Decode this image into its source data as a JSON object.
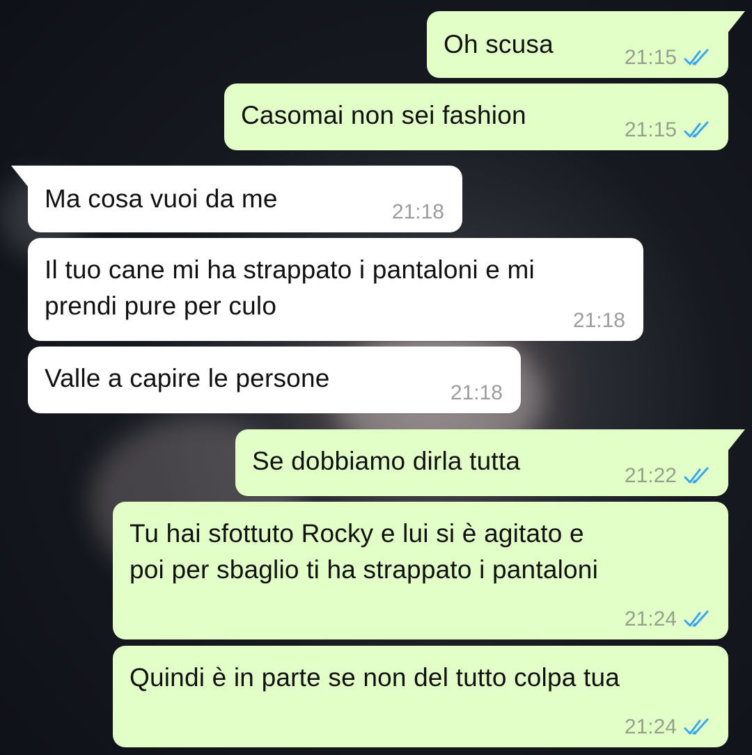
{
  "colors": {
    "outgoing_bubble": "#e2ffc8",
    "incoming_bubble": "#ffffff",
    "read_tick": "#34a6f2",
    "background": "#16191f"
  },
  "messages": [
    {
      "direction": "outgoing",
      "text": "Oh scusa",
      "time": "21:15",
      "status_icon": "double-check-read-icon"
    },
    {
      "direction": "outgoing",
      "text": "Casomai non sei fashion",
      "time": "21:15",
      "status_icon": "double-check-read-icon"
    },
    {
      "direction": "incoming",
      "text": "Ma cosa vuoi da me",
      "time": "21:18"
    },
    {
      "direction": "incoming",
      "text": "Il tuo cane mi ha strappato i pantaloni e mi\nprendi pure per culo",
      "time": "21:18"
    },
    {
      "direction": "incoming",
      "text": "Valle a capire le persone",
      "time": "21:18"
    },
    {
      "direction": "outgoing",
      "text": "Se dobbiamo dirla tutta",
      "time": "21:22",
      "status_icon": "double-check-read-icon"
    },
    {
      "direction": "outgoing",
      "text": "Tu hai sfottuto Rocky e lui si è agitato e\npoi per sbaglio ti ha strappato i pantaloni",
      "time": "21:24",
      "status_icon": "double-check-read-icon"
    },
    {
      "direction": "outgoing",
      "text": "Quindi è in parte se non del tutto colpa tua",
      "time": "21:24",
      "status_icon": "double-check-read-icon"
    }
  ]
}
